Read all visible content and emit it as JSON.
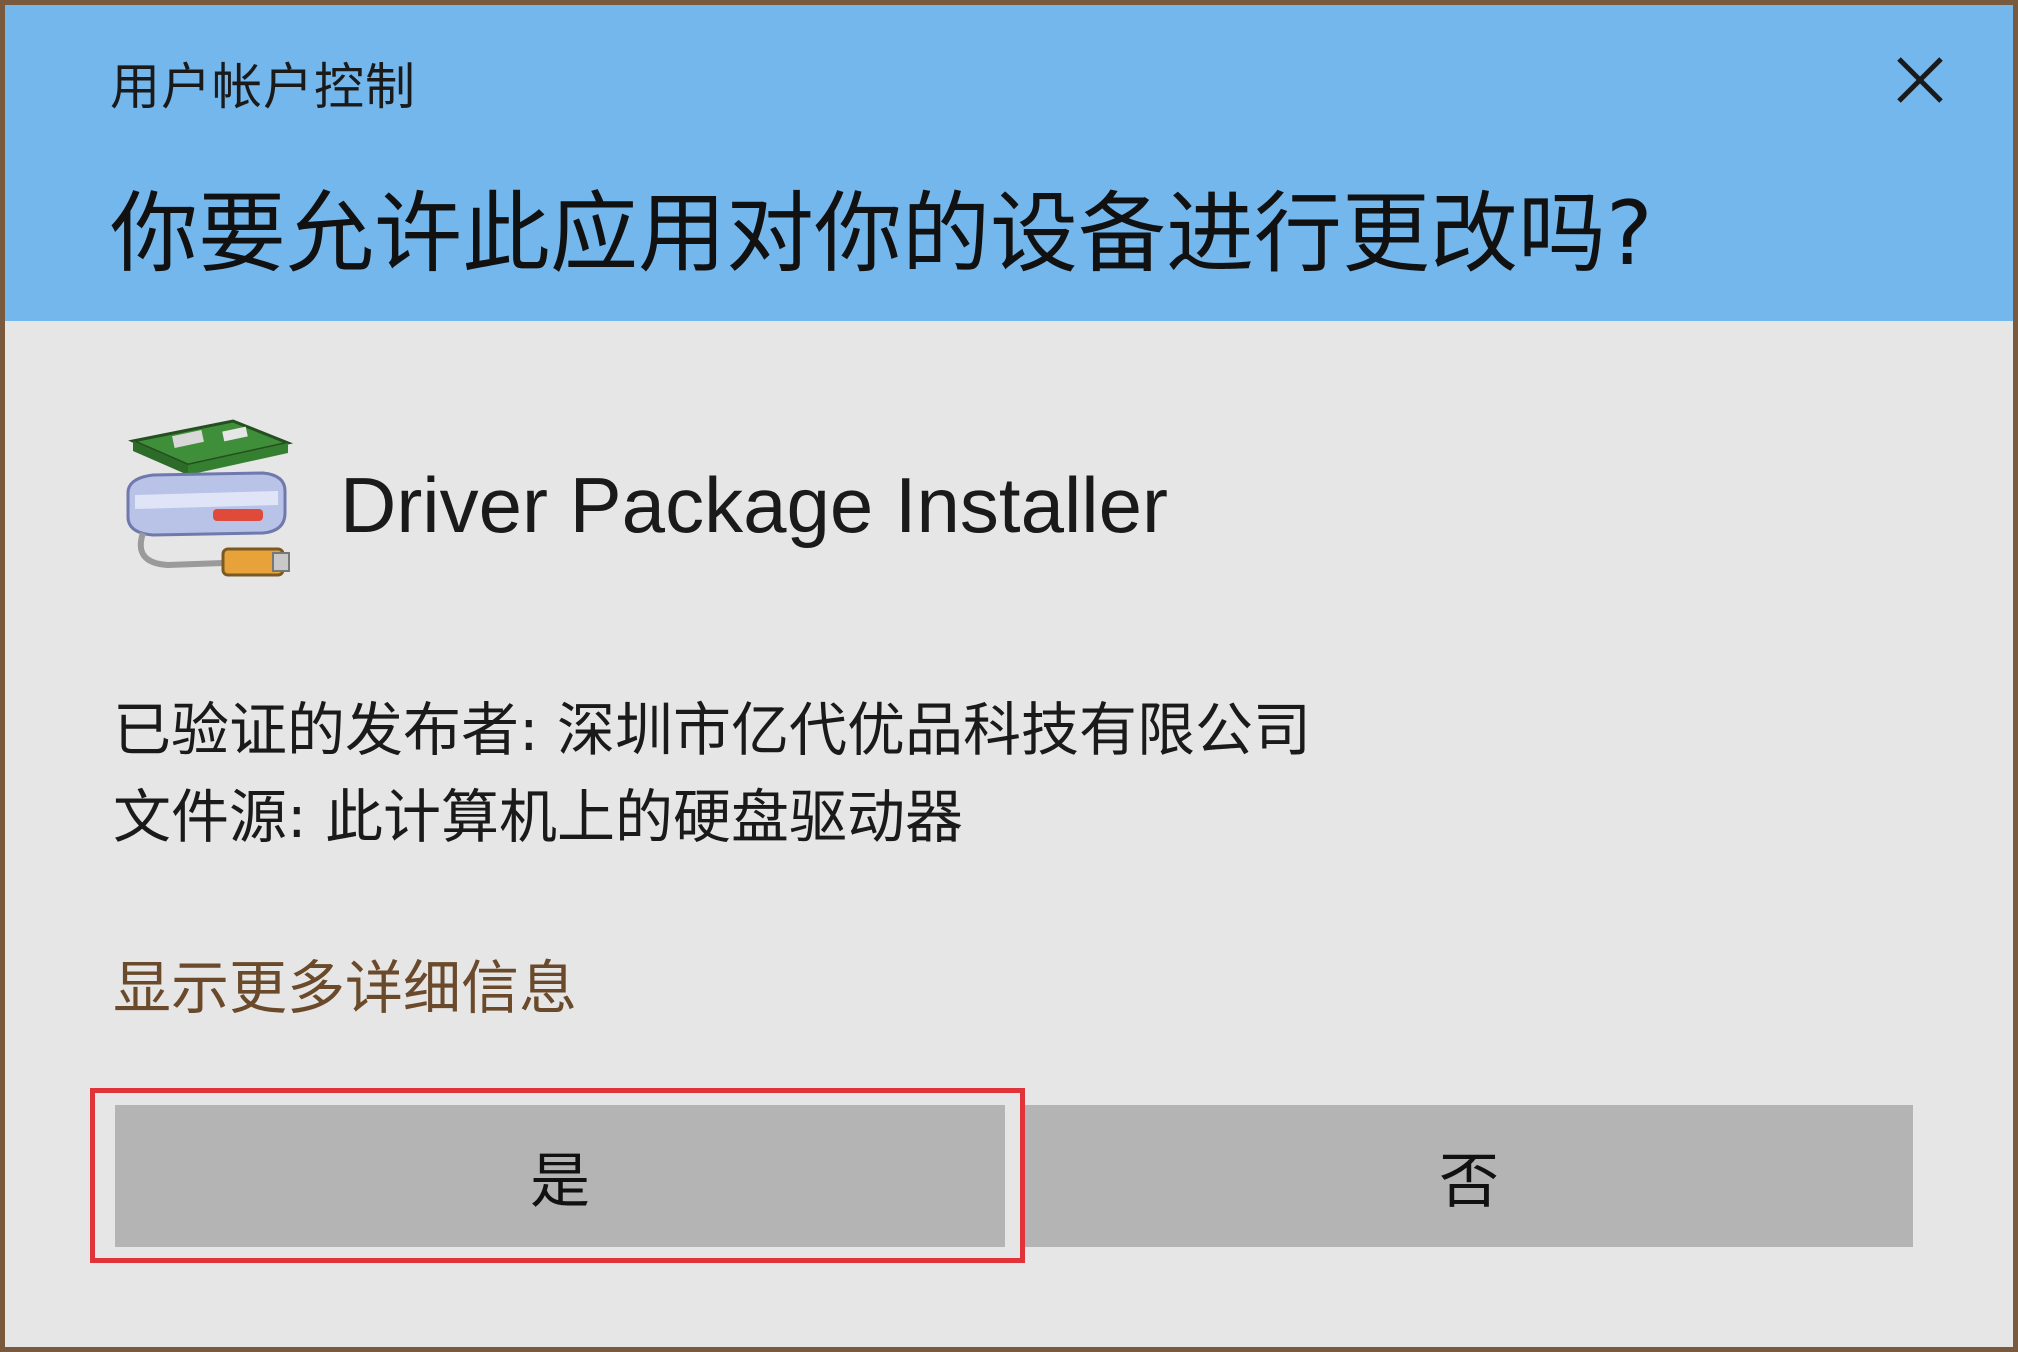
{
  "dialog": {
    "caption": "用户帐户控制",
    "question": "你要允许此应用对你的设备进行更改吗?",
    "close_icon": "close-icon",
    "header_color": "#74b7ec",
    "background_color": "#e6e6e6"
  },
  "app": {
    "icon": "driver-package-icon",
    "name": "Driver Package Installer"
  },
  "info": {
    "publisher": "已验证的发布者: 深圳市亿代优品科技有限公司",
    "source": "文件源: 此计算机上的硬盘驱动器"
  },
  "details_link": "显示更多详细信息",
  "buttons": {
    "yes": "是",
    "no": "否"
  },
  "highlight_color": "#e0343a"
}
